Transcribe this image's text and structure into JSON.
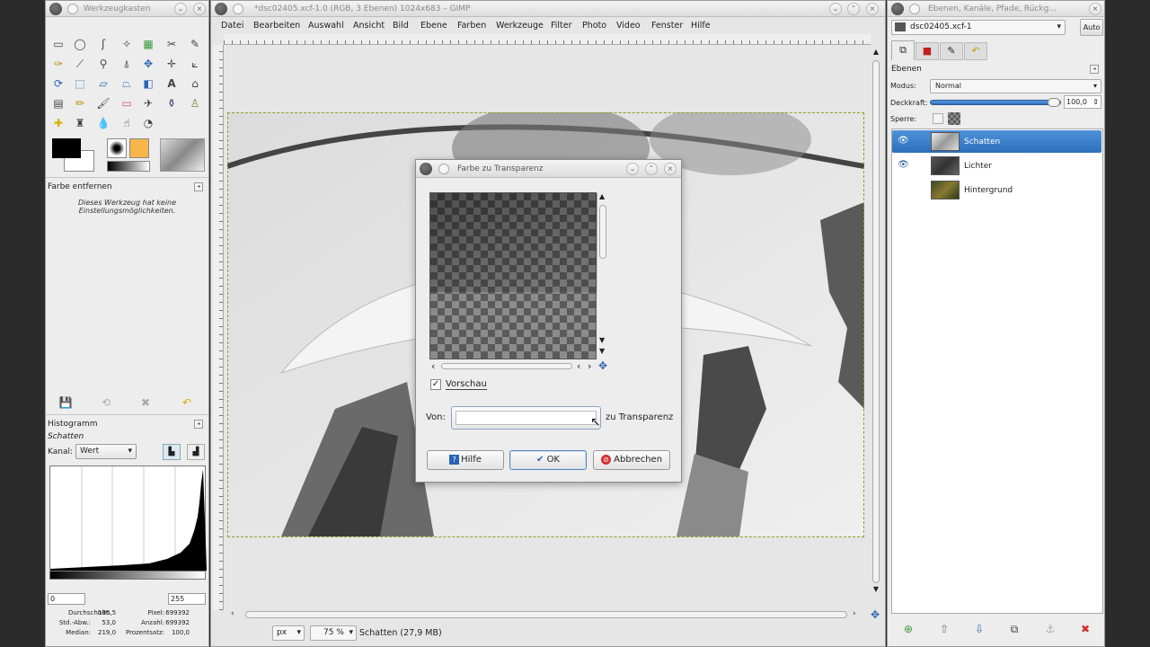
{
  "toolbox": {
    "title": "Werkzeugkasten",
    "options_title": "Farbe entfernen",
    "options_text_1": "Dieses Werkzeug hat keine",
    "options_text_2": "Einstellungsmöglichkeiten.",
    "histogram_title": "Histogramm",
    "histogram_layer": "Schatten",
    "channel_label": "Kanal:",
    "channel_value": "Wert",
    "range_min": "0",
    "range_max": "255",
    "stats": {
      "mean_label": "Durchschnitt:",
      "mean_value": "196,5",
      "std_label": "Std.-Abw.:",
      "std_value": "53,0",
      "median_label": "Median:",
      "median_value": "219,0",
      "pixels_label": "Pixel:",
      "pixels_value": "699392",
      "count_label": "Anzahl:",
      "count_value": "699392",
      "percentile_label": "Prozentsatz:",
      "percentile_value": "100,0"
    }
  },
  "main_window": {
    "title": "*dsc02405.xcf-1.0 (RGB, 3 Ebenen) 1024x683 – GIMP",
    "menu": [
      "Datei",
      "Bearbeiten",
      "Auswahl",
      "Ansicht",
      "Bild",
      "Ebene",
      "Farben",
      "Werkzeuge",
      "Filter",
      "Photo",
      "Video",
      "Fenster",
      "Hilfe"
    ],
    "unit": "px",
    "zoom": "75 %",
    "status_text": "Schatten (27,9 MB)"
  },
  "dialog": {
    "title": "Farbe zu Transparenz",
    "preview_label": "Vorschau",
    "preview_checked": true,
    "from_label": "Von:",
    "to_label": "zu Transparenz",
    "help_button": "Hilfe",
    "ok_button": "OK",
    "cancel_button": "Abbrechen"
  },
  "layers_window": {
    "title": "Ebenen, Kanäle, Pfade, Rückg...",
    "image_select": "dsc02405.xcf-1",
    "auto_button": "Auto",
    "panel_title": "Ebenen",
    "mode_label": "Modus:",
    "mode_value": "Normal",
    "opacity_label": "Deckkraft:",
    "opacity_value": "100,0",
    "lock_label": "Sperre:",
    "layers": [
      {
        "name": "Schatten",
        "visible": true,
        "selected": true
      },
      {
        "name": "Lichter",
        "visible": true,
        "selected": false
      },
      {
        "name": "Hintergrund",
        "visible": false,
        "selected": false
      }
    ]
  },
  "colors": {
    "selection": "#2d6fbd",
    "fg_color": "#000000",
    "bg_color": "#ffffff",
    "pattern_color": "#f7b54a"
  }
}
